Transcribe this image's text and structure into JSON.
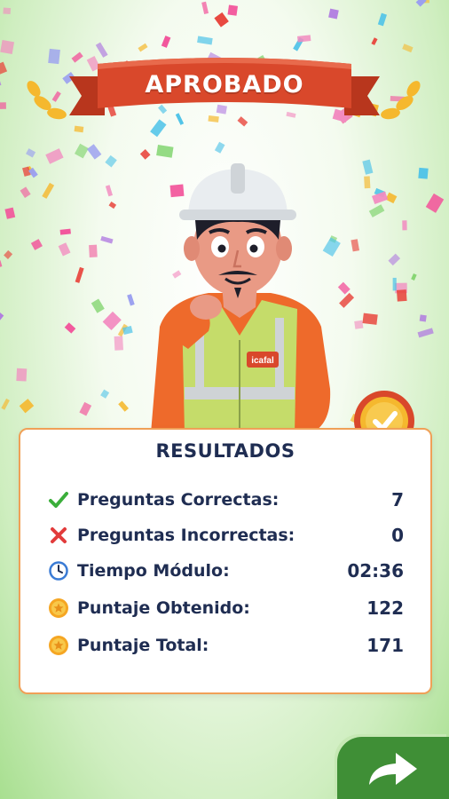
{
  "banner": {
    "title": "APROBADO"
  },
  "worker": {
    "vest_logo": "icafal"
  },
  "results": {
    "title": "RESULTADOS",
    "rows": [
      {
        "icon": "check-icon",
        "label": "Preguntas Correctas:",
        "value": "7"
      },
      {
        "icon": "cross-icon",
        "label": "Preguntas Incorrectas:",
        "value": "0"
      },
      {
        "icon": "clock-icon",
        "label": "Tiempo Módulo:",
        "value": "02:36"
      },
      {
        "icon": "star-coin-icon",
        "label": "Puntaje Obtenido:",
        "value": "122"
      },
      {
        "icon": "star-coin-icon",
        "label": "Puntaje Total:",
        "value": "171"
      }
    ]
  },
  "colors": {
    "banner_red": "#d9482b",
    "card_border": "#f0a057",
    "text_navy": "#1f2d52",
    "button_green": "#3f8f36",
    "check_green": "#3bae3b",
    "cross_red": "#e23b3b"
  },
  "next_button": {
    "icon": "arrow-right-icon"
  }
}
